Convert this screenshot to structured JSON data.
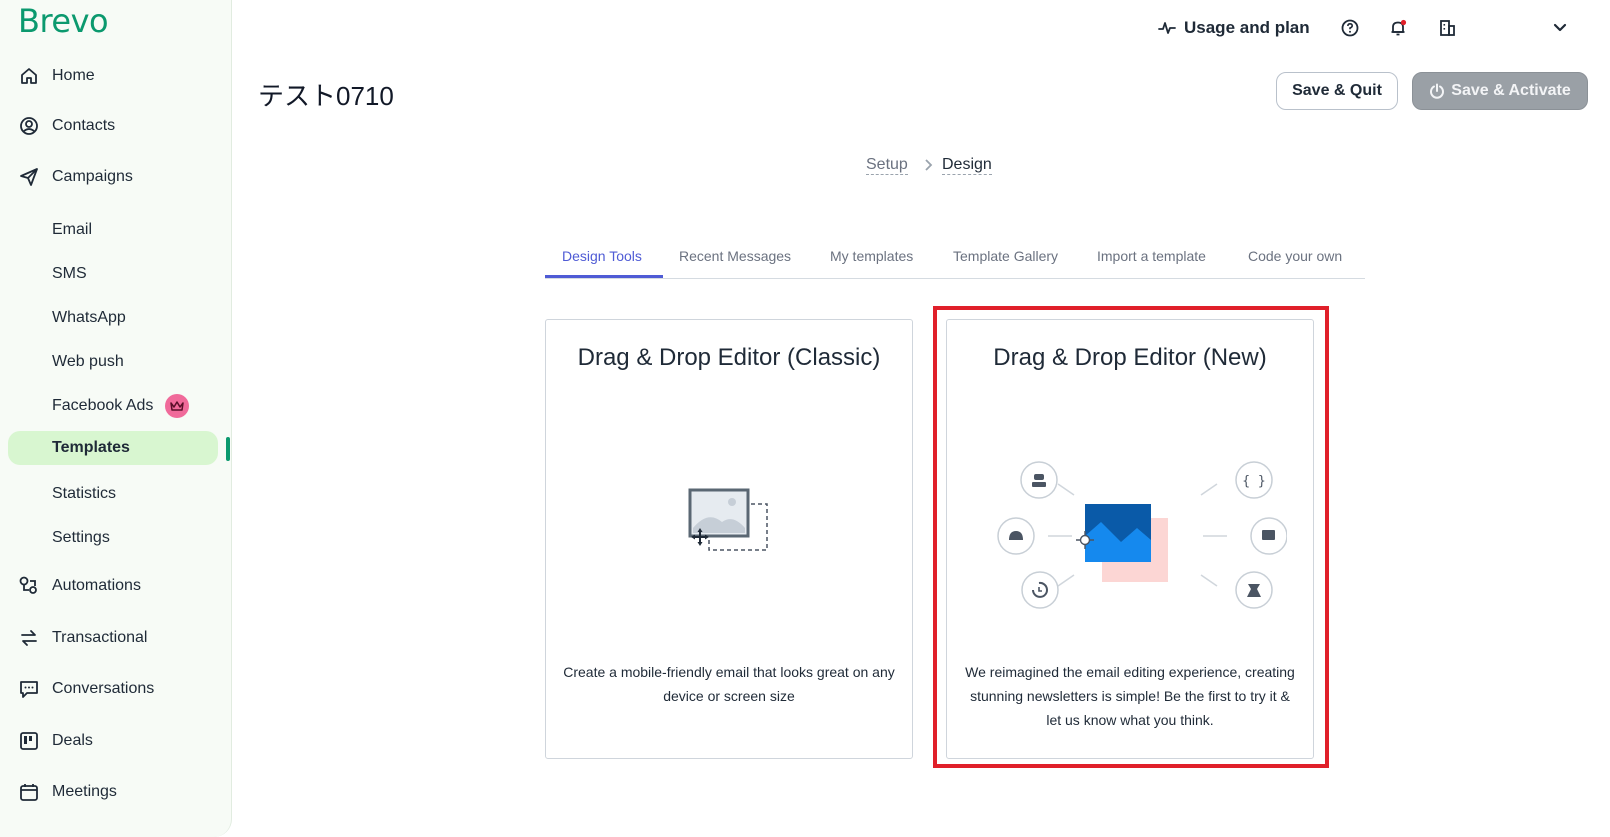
{
  "brand": "Brevo",
  "sidebar": {
    "items": [
      {
        "label": "Home",
        "icon": "home-icon"
      },
      {
        "label": "Contacts",
        "icon": "contacts-icon"
      },
      {
        "label": "Campaigns",
        "icon": "send-icon"
      },
      {
        "label": "Automations",
        "icon": "automation-icon"
      },
      {
        "label": "Transactional",
        "icon": "transactional-icon"
      },
      {
        "label": "Conversations",
        "icon": "conversations-icon"
      },
      {
        "label": "Deals",
        "icon": "deals-icon"
      },
      {
        "label": "Meetings",
        "icon": "calendar-icon"
      }
    ],
    "campaign_sub": [
      "Email",
      "SMS",
      "WhatsApp",
      "Web push",
      "Facebook Ads",
      "Templates",
      "Statistics",
      "Settings"
    ],
    "active_item": "Templates"
  },
  "topbar": {
    "usage_label": "Usage and plan"
  },
  "page": {
    "title": "テスト0710",
    "save_quit": "Save & Quit",
    "save_activate": "Save & Activate"
  },
  "breadcrumb": {
    "step1": "Setup",
    "step2": "Design"
  },
  "tabs": [
    "Design Tools",
    "Recent Messages",
    "My templates",
    "Template Gallery",
    "Import a template",
    "Code your own"
  ],
  "active_tab": "Design Tools",
  "cards": {
    "classic": {
      "title": "Drag & Drop Editor (Classic)",
      "description": "Create a mobile-friendly email that looks great on any device or screen size"
    },
    "new": {
      "title": "Drag & Drop Editor (New)",
      "description": "We reimagined the email editing experience, creating stunning newsletters is simple! Be the first to try it & let us know what you think."
    }
  },
  "colors": {
    "brand": "#0b996e",
    "active_tab": "#4f5bd5",
    "highlight": "#e0202a",
    "sidebar_active_bg": "#d8f6d0"
  }
}
